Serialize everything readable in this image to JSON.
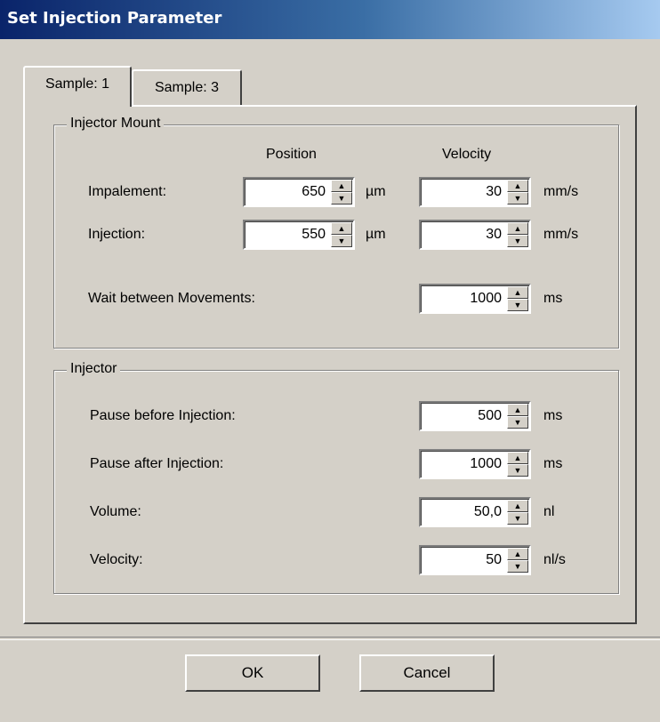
{
  "window": {
    "title": "Set Injection Parameter"
  },
  "tabs": [
    {
      "label": "Sample: 1",
      "active": true
    },
    {
      "label": "Sample: 3",
      "active": false
    }
  ],
  "injector_mount": {
    "group_label": "Injector Mount",
    "col_position": "Position",
    "col_velocity": "Velocity",
    "impalement": {
      "label": "Impalement:",
      "position": "650",
      "position_unit": "µm",
      "velocity": "30",
      "velocity_unit": "mm/s"
    },
    "injection": {
      "label": "Injection:",
      "position": "550",
      "position_unit": "µm",
      "velocity": "30",
      "velocity_unit": "mm/s"
    },
    "wait": {
      "label": "Wait between Movements:",
      "value": "1000",
      "unit": "ms"
    }
  },
  "injector": {
    "group_label": "Injector",
    "pause_before": {
      "label": "Pause before Injection:",
      "value": "500",
      "unit": "ms"
    },
    "pause_after": {
      "label": "Pause after Injection:",
      "value": "1000",
      "unit": "ms"
    },
    "volume": {
      "label": "Volume:",
      "value": "50,0",
      "unit": "nl"
    },
    "velocity": {
      "label": "Velocity:",
      "value": "50",
      "unit": "nl/s"
    }
  },
  "buttons": {
    "ok": "OK",
    "cancel": "Cancel"
  },
  "icons": {
    "spin_up": "triangle-up",
    "spin_down": "triangle-down"
  }
}
